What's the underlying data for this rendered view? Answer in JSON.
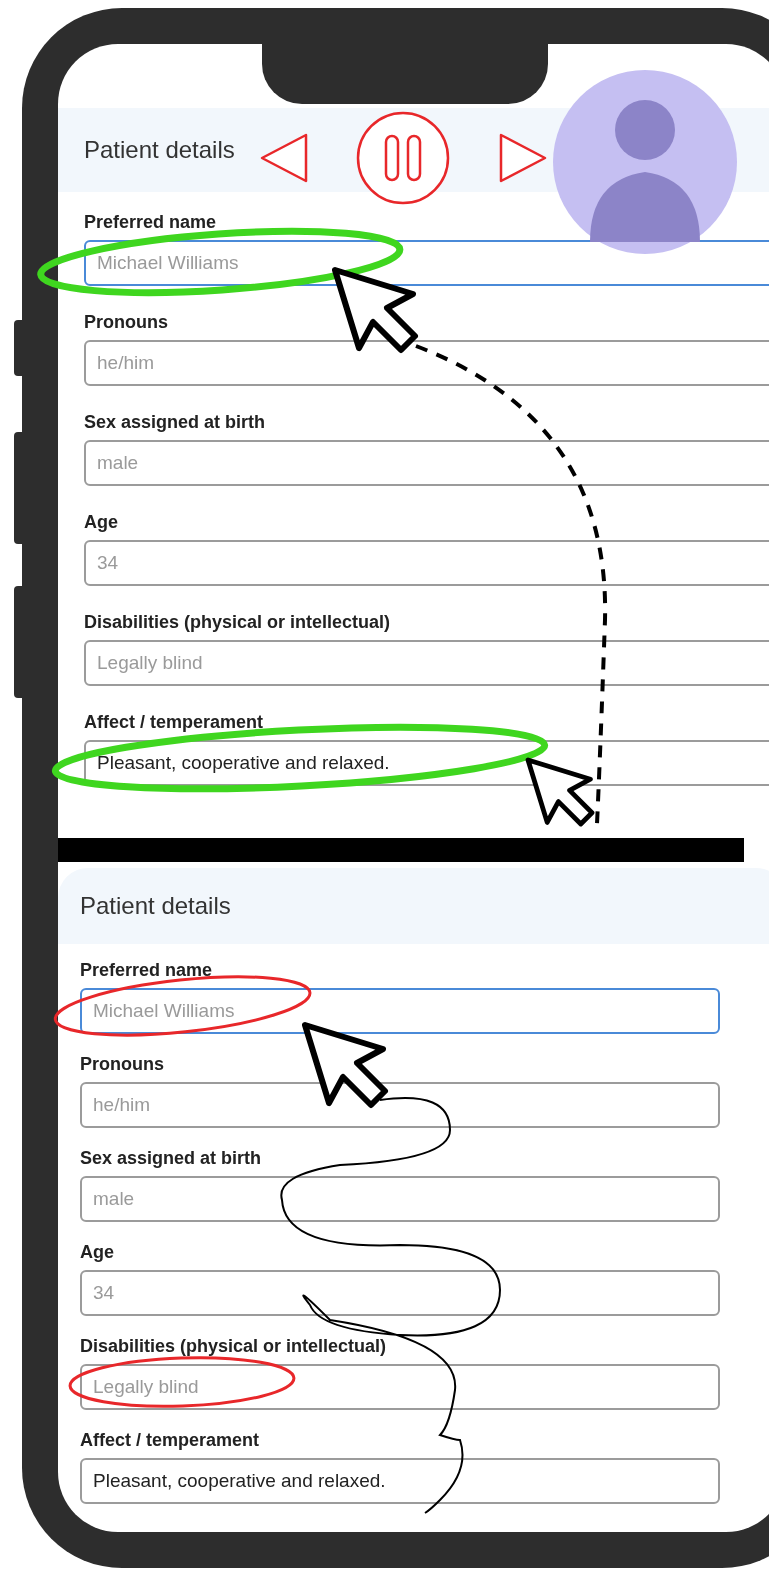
{
  "panels": [
    {
      "title": "Patient details",
      "fields": [
        {
          "label": "Preferred name",
          "placeholder": "Michael Williams",
          "focused": true
        },
        {
          "label": "Pronouns",
          "placeholder": "he/him",
          "focused": false
        },
        {
          "label": "Sex assigned at birth",
          "placeholder": "male",
          "focused": false
        },
        {
          "label": "Age",
          "placeholder": "34",
          "focused": false
        },
        {
          "label": "Disabilities (physical or intellectual)",
          "placeholder": "Legally blind",
          "focused": false
        },
        {
          "label": "Affect / temperament",
          "value": "Pleasant, cooperative and relaxed.",
          "focused": false
        }
      ]
    },
    {
      "title": "Patient details",
      "fields": [
        {
          "label": "Preferred name",
          "placeholder": "Michael Williams",
          "focused": true
        },
        {
          "label": "Pronouns",
          "placeholder": "he/him",
          "focused": false
        },
        {
          "label": "Sex assigned at birth",
          "placeholder": "male",
          "focused": false
        },
        {
          "label": "Age",
          "placeholder": "34",
          "focused": false
        },
        {
          "label": "Disabilities (physical or intellectual)",
          "placeholder": "Legally blind",
          "focused": false
        },
        {
          "label": "Affect / temperament",
          "value": "Pleasant, cooperative and relaxed.",
          "focused": false
        }
      ]
    }
  ]
}
